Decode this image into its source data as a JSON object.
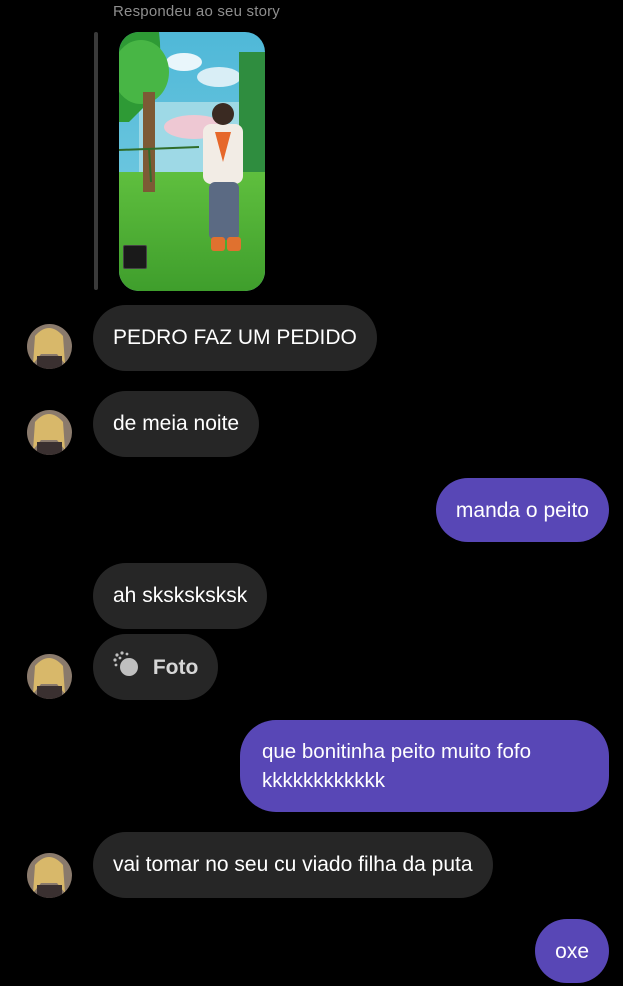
{
  "story": {
    "reply_label": "Respondeu ao seu story"
  },
  "messages": [
    {
      "id": "m1",
      "side": "received",
      "text": "PEDRO FAZ UM PEDIDO"
    },
    {
      "id": "m2",
      "side": "received",
      "text": "de meia noite"
    },
    {
      "id": "m3",
      "side": "sent",
      "text": "manda o peito"
    },
    {
      "id": "m4",
      "side": "received",
      "text": "ah sksksksksk"
    },
    {
      "id": "m5",
      "side": "received",
      "type": "photo",
      "icon": "view-once-photo-icon",
      "text": "Foto"
    },
    {
      "id": "m6",
      "side": "sent",
      "text": "que bonitinha peito muito fofo kkkkkkkkkkkk"
    },
    {
      "id": "m7",
      "side": "received",
      "text": "vai tomar no seu cu viado filha da puta"
    },
    {
      "id": "m8",
      "side": "sent",
      "text": "oxe"
    }
  ],
  "colors": {
    "background": "#000000",
    "received_bubble": "#262626",
    "sent_bubble": "#5847b6",
    "muted_text": "#8e8e8e"
  }
}
